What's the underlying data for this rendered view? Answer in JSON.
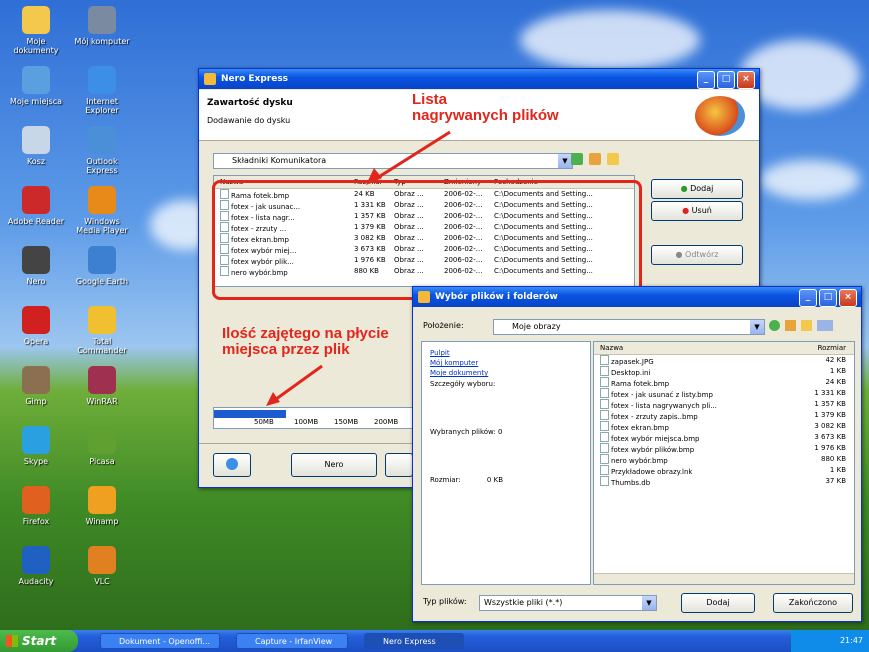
{
  "desktop": {
    "icons": [
      {
        "label": "Moje dokumenty",
        "color": "#f2c94c"
      },
      {
        "label": "Mój komputer",
        "color": "#7a8aa0"
      },
      {
        "label": "Moje miejsca",
        "color": "#5aa0e0"
      },
      {
        "label": "Internet Explorer",
        "color": "#3d8ee6"
      },
      {
        "label": "Kosz",
        "color": "#c7d7e8"
      },
      {
        "label": "Outlook Express",
        "color": "#4a8fd8"
      },
      {
        "label": "Adobe Reader",
        "color": "#cc2a2a"
      },
      {
        "label": "Windows Media Player",
        "color": "#e88a1a"
      },
      {
        "label": "Nero",
        "color": "#444"
      },
      {
        "label": "Google Earth",
        "color": "#3d7fd0"
      },
      {
        "label": "Opera",
        "color": "#d02020"
      },
      {
        "label": "Total Commander",
        "color": "#f0c030"
      },
      {
        "label": "Gimp",
        "color": "#8a7050"
      },
      {
        "label": "WinRAR",
        "color": "#a03050"
      },
      {
        "label": "Skype",
        "color": "#2aa0e0"
      },
      {
        "label": "Picasa",
        "color": "#5fa030"
      },
      {
        "label": "Firefox",
        "color": "#e06020"
      },
      {
        "label": "Winamp",
        "color": "#f0a020"
      },
      {
        "label": "Audacity",
        "color": "#2060c0"
      },
      {
        "label": "VLC",
        "color": "#e08020"
      }
    ]
  },
  "main_window": {
    "title": "Nero Express",
    "heading": "Zawartość dysku",
    "subheading": "Dodawanie do dysku",
    "folder_combo": "Składniki Komunikatora",
    "columns": [
      "Nazwa",
      "Rozmiar",
      "Typ",
      "Zmieniony",
      "Pochodzenie"
    ],
    "files": [
      {
        "name": "Rama fotek.bmp",
        "size": "24 KB",
        "type": "Obraz ...",
        "date": "2006-02-...",
        "origin": "C:\\Documents and Setting..."
      },
      {
        "name": "fotex - jak usunac...",
        "size": "1 331 KB",
        "type": "Obraz ...",
        "date": "2006-02-...",
        "origin": "C:\\Documents and Setting..."
      },
      {
        "name": "fotex - lista nagr...",
        "size": "1 357 KB",
        "type": "Obraz ...",
        "date": "2006-02-...",
        "origin": "C:\\Documents and Setting..."
      },
      {
        "name": "fotex - zrzuty ...",
        "size": "1 379 KB",
        "type": "Obraz ...",
        "date": "2006-02-...",
        "origin": "C:\\Documents and Setting..."
      },
      {
        "name": "fotex ekran.bmp",
        "size": "3 082 KB",
        "type": "Obraz ...",
        "date": "2006-02-...",
        "origin": "C:\\Documents and Setting..."
      },
      {
        "name": "fotex wybór miej...",
        "size": "3 673 KB",
        "type": "Obraz ...",
        "date": "2006-02-...",
        "origin": "C:\\Documents and Setting..."
      },
      {
        "name": "fotex wybór plik...",
        "size": "1 976 KB",
        "type": "Obraz ...",
        "date": "2006-02-...",
        "origin": "C:\\Documents and Setting..."
      },
      {
        "name": "nero wybór.bmp",
        "size": "880 KB",
        "type": "Obraz ...",
        "date": "2006-02-...",
        "origin": "C:\\Documents and Setting..."
      }
    ],
    "side_buttons": [
      "Dodaj",
      "Usuń",
      "Odtwórz"
    ],
    "scale_ticks": [
      "50MB",
      "100MB",
      "150MB",
      "200MB"
    ],
    "bottom_buttons": [
      "Nero"
    ]
  },
  "annotations": {
    "list_label_line1": "Lista",
    "list_label_line2": "nagrywanych plików",
    "space_label_line1": "Ilość zajętego na płycie",
    "space_label_line2": "miejsca przez plik"
  },
  "dialog": {
    "title": "Wybór plików i folderów",
    "location_label": "Położenie:",
    "location_value": "Moje obrazy",
    "links": [
      "Pulpit",
      "Mój komputer",
      "Moje dokumenty"
    ],
    "info_lines": [
      "Szczegóły wyboru:",
      "Wybranych plików: 0",
      "Rozmiar:",
      "0 KB"
    ],
    "columns": [
      "Nazwa",
      "Rozmiar"
    ],
    "files": [
      {
        "name": "zapasek.JPG",
        "size": "42 KB"
      },
      {
        "name": "Desktop.ini",
        "size": "1 KB"
      },
      {
        "name": "Rama fotek.bmp",
        "size": "24 KB"
      },
      {
        "name": "fotex - jak usunać z listy.bmp",
        "size": "1 331 KB"
      },
      {
        "name": "fotex - lista nagrywanych pli...",
        "size": "1 357 KB"
      },
      {
        "name": "fotex - zrzuty zapis..bmp",
        "size": "1 379 KB"
      },
      {
        "name": "fotex ekran.bmp",
        "size": "3 082 KB"
      },
      {
        "name": "fotex wybór miejsca.bmp",
        "size": "3 673 KB"
      },
      {
        "name": "fotex wybór plików.bmp",
        "size": "1 976 KB"
      },
      {
        "name": "nero wybór.bmp",
        "size": "880 KB"
      },
      {
        "name": "Przykładowe obrazy.lnk",
        "size": "1 KB"
      },
      {
        "name": "Thumbs.db",
        "size": "37 KB"
      }
    ],
    "filetype_label": "Typ plików:",
    "filetype_value": "Wszystkie pliki (*.*)",
    "add_button": "Dodaj",
    "close_button": "Zakończono"
  },
  "taskbar": {
    "start_label": "Start",
    "items": [
      "Dokument - Openoffi...",
      "Capture - IrfanView",
      "Nero Express"
    ],
    "clock": "21:47"
  }
}
